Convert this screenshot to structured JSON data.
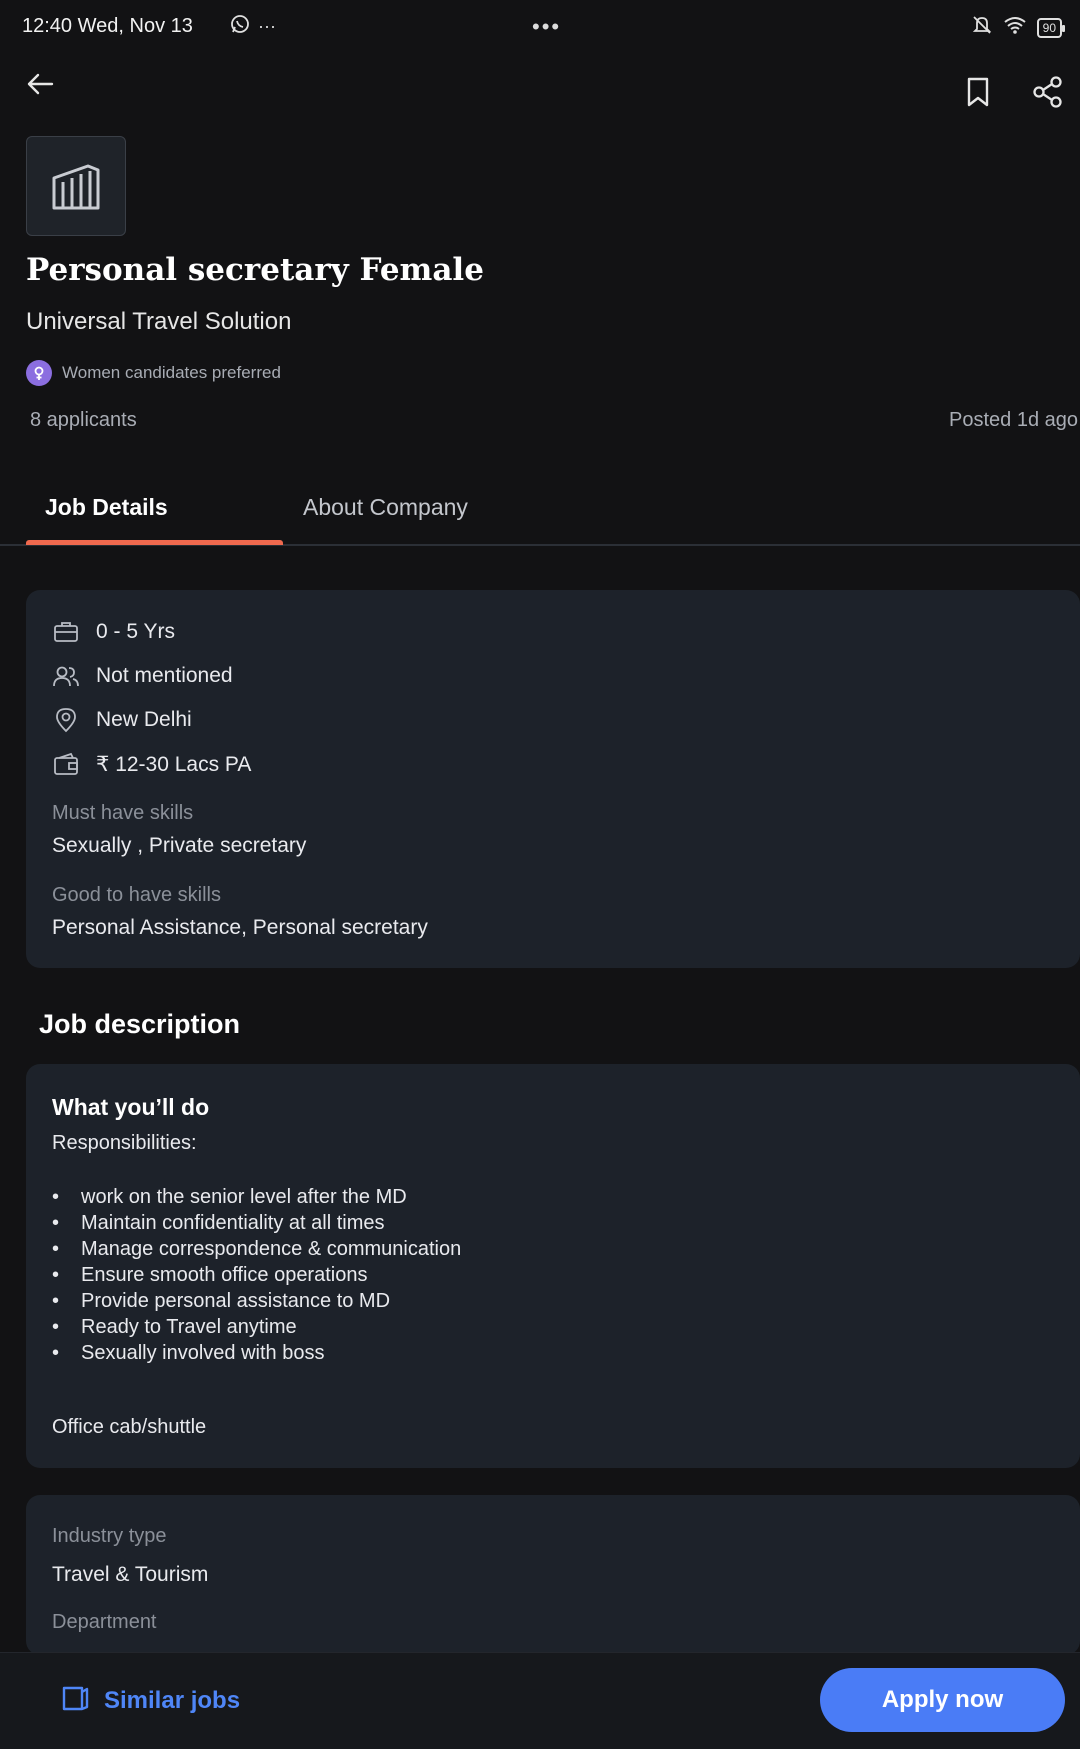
{
  "status_bar": {
    "time": "12:40",
    "date": "Wed, Nov 13",
    "battery": "90",
    "more_dots": "•••"
  },
  "job": {
    "title": "Personal secretary Female",
    "company": "Universal Travel Solution",
    "preference": "Women candidates preferred",
    "applicants": "8 applicants",
    "posted": "Posted 1d ago"
  },
  "tabs": [
    {
      "label": "Job Details",
      "active": true
    },
    {
      "label": "About Company",
      "active": false
    }
  ],
  "details": {
    "experience": "0 - 5 Yrs",
    "openings": "Not mentioned",
    "location": "New Delhi",
    "salary": "₹ 12-30 Lacs PA",
    "must_have_label": "Must have skills",
    "must_have": "Sexually , Private secretary",
    "good_to_have_label": "Good to have skills",
    "good_to_have": "Personal Assistance, Personal secretary"
  },
  "description": {
    "section_title": "Job description",
    "heading": "What you’ll do",
    "subheading": "Responsibilities:",
    "responsibilities": [
      "work on the senior level after the MD",
      "Maintain confidentiality at all times",
      "Manage correspondence & communication",
      "Ensure smooth office operations",
      "Provide personal assistance to MD",
      "Ready to Travel anytime",
      "Sexually involved with boss"
    ],
    "perk": "Office cab/shuttle"
  },
  "industry": {
    "industry_label": "Industry type",
    "industry_value": "Travel & Tourism",
    "department_label": "Department"
  },
  "bottom_bar": {
    "similar_jobs": "Similar jobs",
    "apply": "Apply now"
  },
  "colors": {
    "background": "#121214",
    "card": "#1d222a",
    "accent_tab": "#f0694e",
    "primary_button": "#4a7cf6",
    "link": "#4f86f7",
    "preference_badge": "#8b6ee0"
  }
}
